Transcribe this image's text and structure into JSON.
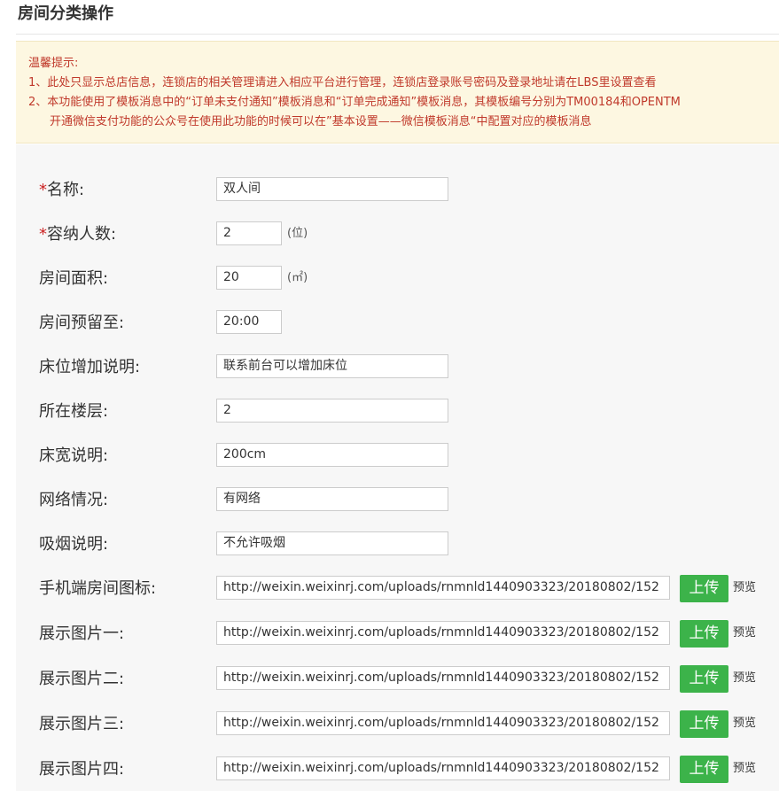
{
  "page": {
    "title": "房间分类操作"
  },
  "tips": {
    "heading": "温馨提示:",
    "line1": "1、此处只显示总店信息，连锁店的相关管理请进入相应平台进行管理，连锁店登录账号密码及登录地址请在LBS里设置查看",
    "line2": "2、本功能使用了模板消息中的“订单未支付通知”模板消息和“订单完成通知”模板消息，其模板编号分别为TM00184和OPENTM",
    "line3": "开通微信支付功能的公众号在使用此功能的时候可以在”基本设置——微信模板消息“中配置对应的模板消息"
  },
  "form": {
    "name": {
      "required": "*",
      "label": "名称:",
      "value": "双人间"
    },
    "capacity": {
      "required": "*",
      "label": "容纳人数:",
      "value": "2",
      "unit": "(位)"
    },
    "area": {
      "label": "房间面积:",
      "value": "20",
      "unit": "(㎡)"
    },
    "reserve": {
      "label": "房间预留至:",
      "value": "20:00"
    },
    "extra_bed": {
      "label": "床位增加说明:",
      "value": "联系前台可以增加床位"
    },
    "floor": {
      "label": "所在楼层:",
      "value": "2"
    },
    "bed_width": {
      "label": "床宽说明:",
      "value": "200cm"
    },
    "network": {
      "label": "网络情况:",
      "value": "有网络"
    },
    "smoking": {
      "label": "吸烟说明:",
      "value": "不允许吸烟"
    },
    "mobile_icon": {
      "label": "手机端房间图标:",
      "value": "http://weixin.weixinrj.com/uploads/rnmnld1440903323/20180802/152"
    },
    "image1": {
      "label": "展示图片一:",
      "value": "http://weixin.weixinrj.com/uploads/rnmnld1440903323/20180802/152"
    },
    "image2": {
      "label": "展示图片二:",
      "value": "http://weixin.weixinrj.com/uploads/rnmnld1440903323/20180802/152"
    },
    "image3": {
      "label": "展示图片三:",
      "value": "http://weixin.weixinrj.com/uploads/rnmnld1440903323/20180802/152"
    },
    "image4": {
      "label": "展示图片四:",
      "value": "http://weixin.weixinrj.com/uploads/rnmnld1440903323/20180802/152"
    },
    "upload_label": "上传",
    "preview_label": "预览"
  },
  "colors": {
    "accent_green": "#3cb34a",
    "required_red": "#cc2222",
    "tip_bg": "#fdf7e1",
    "tip_text": "#c0392b"
  }
}
